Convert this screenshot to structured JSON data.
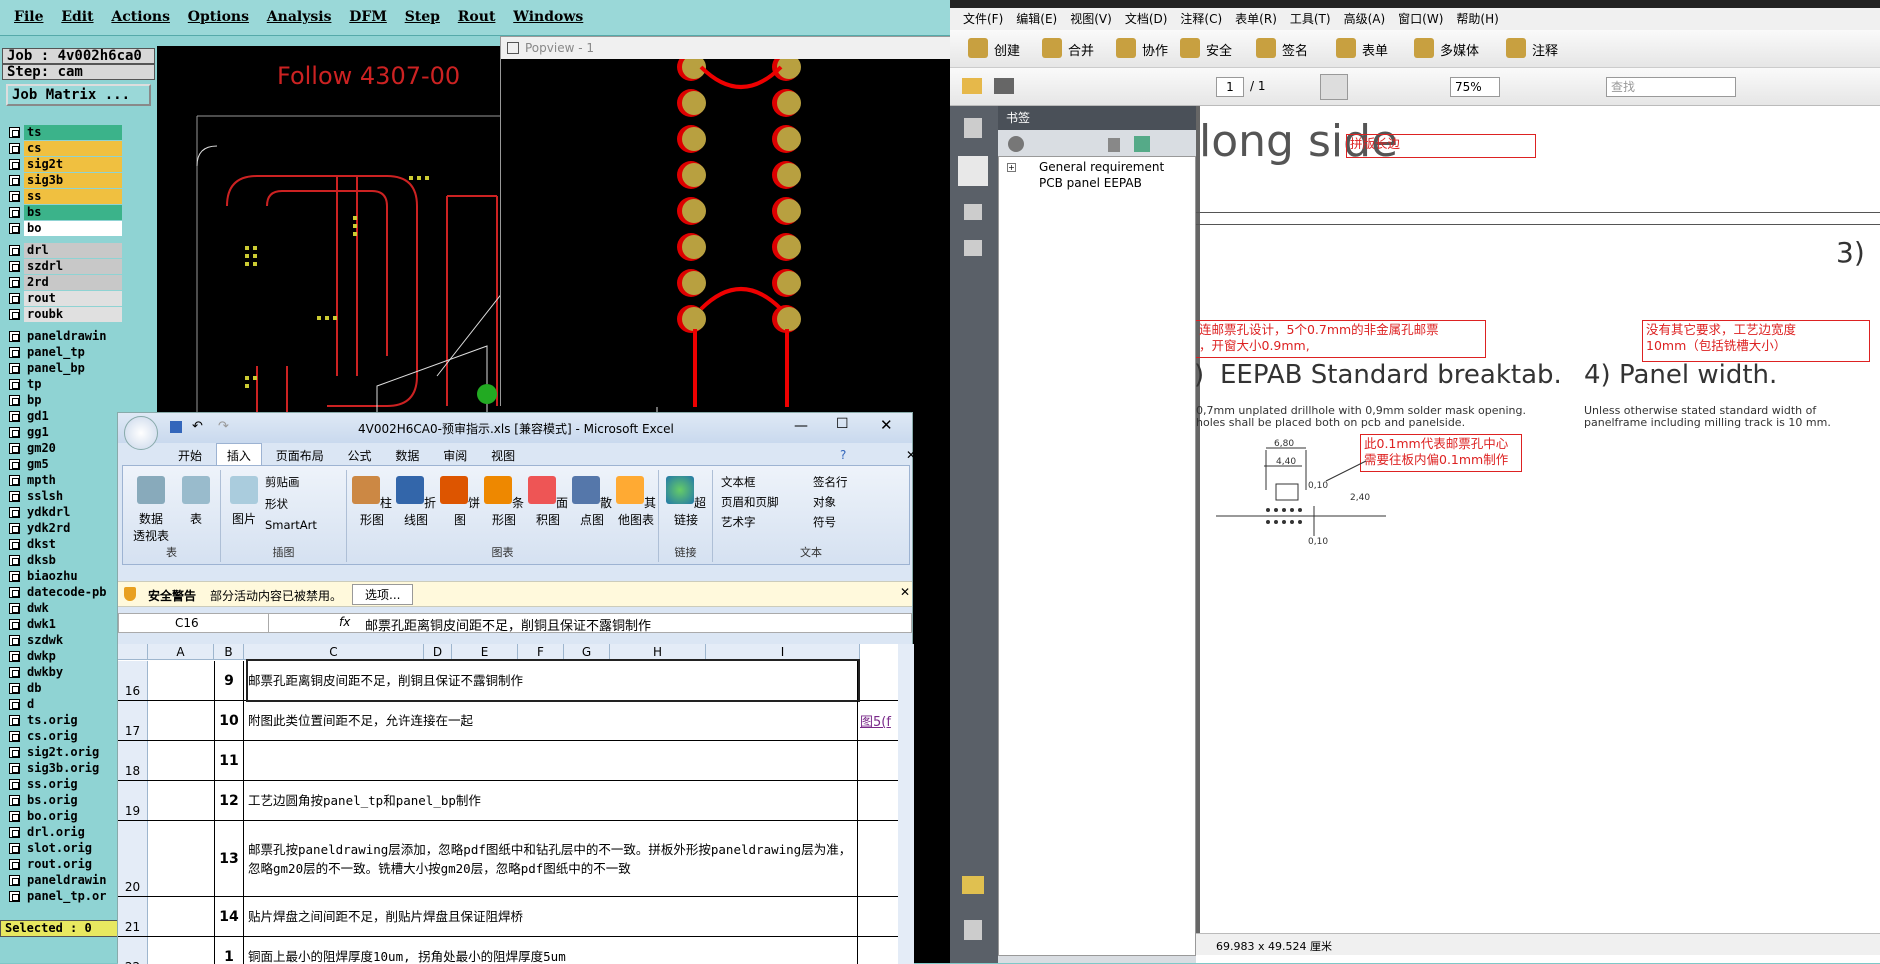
{
  "cam": {
    "menu": [
      "File",
      "Edit",
      "Actions",
      "Options",
      "Analysis",
      "DFM",
      "Step",
      "Rout",
      "Windows"
    ],
    "job_line": "Job : 4v002h6ca0",
    "step_line": "Step: cam",
    "job_matrix_label": "Job Matrix ...",
    "selected_label": "Selected : 0",
    "canvas_text": "Follow 4307-00",
    "layers_group1": [
      {
        "name": "ts",
        "color": "#3bb38a"
      },
      {
        "name": "cs",
        "color": "#f0c040"
      },
      {
        "name": "sig2t",
        "color": "#f0c040"
      },
      {
        "name": "sig3b",
        "color": "#f0c040"
      },
      {
        "name": "ss",
        "color": "#f0c040"
      },
      {
        "name": "bs",
        "color": "#3bb38a"
      },
      {
        "name": "bo",
        "color": "#ffffff"
      }
    ],
    "layers_group2": [
      {
        "name": "drl",
        "color": "#c8c8c8"
      },
      {
        "name": "szdrl",
        "color": "#c8c8c8"
      },
      {
        "name": "2rd",
        "color": "#c8c8c8"
      },
      {
        "name": "rout",
        "color": "#e0e0e0"
      },
      {
        "name": "roubk",
        "color": "#e0e0e0"
      }
    ],
    "layers_group3": [
      "paneldrawin",
      "panel_tp",
      "panel_bp",
      "tp",
      "bp",
      "gd1",
      "gg1",
      "gm20",
      "gm5",
      "mpth",
      "sslsh",
      "ydkdrl",
      "ydk2rd",
      "dkst",
      "dksb",
      "biaozhu",
      "datecode-pb",
      "dwk",
      "dwk1",
      "szdwk",
      "dwkp",
      "dwkby",
      "db",
      "d",
      "ts.orig",
      "cs.orig",
      "sig2t.orig",
      "sig3b.orig",
      "ss.orig",
      "bs.orig",
      "bo.orig",
      "drl.orig",
      "slot.orig",
      "rout.orig",
      "paneldrawin",
      "panel_tp.or"
    ]
  },
  "popview": {
    "title": "Popview - 1"
  },
  "excel": {
    "title": "4V002H6CA0-预审指示.xls  [兼容模式] - Microsoft Excel",
    "tabs": [
      "开始",
      "插入",
      "页面布局",
      "公式",
      "数据",
      "审阅",
      "视图"
    ],
    "groups": {
      "table": {
        "label": "表",
        "pivot": "数据\n透视表",
        "table": "表"
      },
      "illustration": {
        "label": "插图",
        "picture": "图片",
        "clipart": "剪贴画",
        "shapes": "形状",
        "smartart": "SmartArt"
      },
      "charts": {
        "label": "图表",
        "items": [
          "柱形图",
          "折线图",
          "饼图",
          "条形图",
          "面积图",
          "散点图",
          "其他图表"
        ]
      },
      "links": {
        "label": "链接",
        "hyperlink": "超链接"
      },
      "text": {
        "label": "文本",
        "items": [
          "文本框",
          "页眉和页脚",
          "艺术字",
          "签名行",
          "对象",
          "符号"
        ]
      }
    },
    "warning_title": "安全警告",
    "warning_text": "部分活动内容已被禁用。",
    "warning_button": "选项...",
    "cell_ref": "C16",
    "formula": "邮票孔距离铜皮间距不足，削铜且保证不露铜制作",
    "columns": [
      "A",
      "B",
      "C",
      "D",
      "E",
      "F",
      "G",
      "H",
      "I"
    ],
    "rows": [
      {
        "row": "16",
        "num": "9",
        "text": "邮票孔距离铜皮间距不足，削铜且保证不露铜制作",
        "link": ""
      },
      {
        "row": "17",
        "num": "10",
        "text": "附图此类位置间距不足，允许连接在一起",
        "link": "图5(f"
      },
      {
        "row": "18",
        "num": "11",
        "text": "",
        "link": ""
      },
      {
        "row": "19",
        "num": "12",
        "text": "工艺边圆角按panel_tp和panel_bp制作",
        "link": ""
      },
      {
        "row": "20",
        "num": "13",
        "text": "邮票孔按paneldrawing层添加，忽略pdf图纸中和钻孔层中的不一致。拼板外形按paneldrawing层为准，忽略gm20层的不一致。铣槽大小按gm20层，忽略pdf图纸中的不一致",
        "link": ""
      },
      {
        "row": "21",
        "num": "14",
        "text": "贴片焊盘之间间距不足，削贴片焊盘且保证阻焊桥",
        "link": ""
      },
      {
        "row": "22",
        "num": "1",
        "text": "铜面上最小的阻焊厚度10um, 拐角处最小的阻焊厚度5um",
        "link": ""
      }
    ]
  },
  "pdf": {
    "menu": [
      "文件(F)",
      "编辑(E)",
      "视图(V)",
      "文档(D)",
      "注释(C)",
      "表单(R)",
      "工具(T)",
      "高级(A)",
      "窗口(W)",
      "帮助(H)"
    ],
    "toolbar": [
      "创建",
      "合并",
      "协作",
      "安全",
      "签名",
      "表单",
      "多媒体",
      "注释"
    ],
    "page_current": "1",
    "page_total": "/ 1",
    "zoom": "75%",
    "search_placeholder": "查找",
    "bookmarks_title": "书签",
    "bookmark_item": "General requirement PCB panel EEPAB",
    "status_size": "69.983 x 49.524 厘米",
    "page": {
      "heading": "long side",
      "note_long": "拼版长边",
      "num3": "3)",
      "note_cn1_l1": "连邮票孔设计，5个0.7mm的非金属孔邮票",
      "note_cn1_l2": "，开窗大小0.9mm,",
      "note_cn2_l1": "没有其它要求，工艺边宽度",
      "note_cn2_l2": "10mm（包括铣槽大小）",
      "sec3_num": ")",
      "sec3_title": "EEPAB Standard breaktab.",
      "sec4_title": "4)  Panel width.",
      "sec3_text1": "0,7mm unplated drillhole with 0,9mm solder mask opening.",
      "sec3_text2": "holes shall be placed both on pcb and panelside.",
      "sec4_text1": "Unless otherwise stated standard width of",
      "sec4_text2": "panelframe including milling track is 10 mm.",
      "note_cn3_l1": "此0.1mm代表邮票孔中心",
      "note_cn3_l2": "需要往板内偏0.1mm制作",
      "dim1": "6,80",
      "dim2": "4,40",
      "dim3": "0,10",
      "dim4": "2,40",
      "dim5": "0,10"
    }
  }
}
